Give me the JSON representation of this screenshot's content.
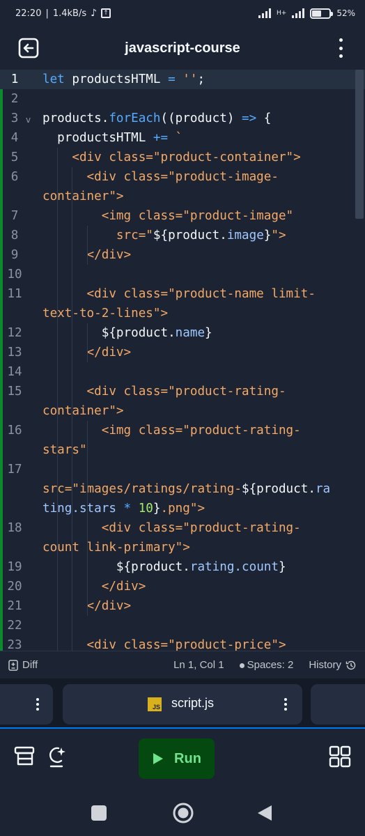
{
  "statusbar": {
    "time": "22:20",
    "network_speed": "1.4kB/s",
    "network_type": "H+",
    "battery_percent": "52",
    "battery_label": "52"
  },
  "header": {
    "title": "javascript-course",
    "back_icon": "exit-icon",
    "menu_icon": "kebab-menu-icon"
  },
  "editor": {
    "active_line": 1,
    "lines": [
      {
        "n": "1",
        "fold": ""
      },
      {
        "n": "2",
        "fold": ""
      },
      {
        "n": "3",
        "fold": "v"
      },
      {
        "n": "4",
        "fold": ""
      },
      {
        "n": "5",
        "fold": ""
      },
      {
        "n": "6",
        "fold": ""
      },
      {
        "n": "",
        "fold": ""
      },
      {
        "n": "7",
        "fold": ""
      },
      {
        "n": "8",
        "fold": ""
      },
      {
        "n": "9",
        "fold": ""
      },
      {
        "n": "10",
        "fold": ""
      },
      {
        "n": "11",
        "fold": ""
      },
      {
        "n": "",
        "fold": ""
      },
      {
        "n": "12",
        "fold": ""
      },
      {
        "n": "13",
        "fold": ""
      },
      {
        "n": "14",
        "fold": ""
      },
      {
        "n": "15",
        "fold": ""
      },
      {
        "n": "",
        "fold": ""
      },
      {
        "n": "16",
        "fold": ""
      },
      {
        "n": "",
        "fold": ""
      },
      {
        "n": "17",
        "fold": ""
      },
      {
        "n": "",
        "fold": ""
      },
      {
        "n": "",
        "fold": ""
      },
      {
        "n": "18",
        "fold": ""
      },
      {
        "n": "",
        "fold": ""
      },
      {
        "n": "19",
        "fold": ""
      },
      {
        "n": "20",
        "fold": ""
      },
      {
        "n": "21",
        "fold": ""
      },
      {
        "n": "22",
        "fold": ""
      },
      {
        "n": "23",
        "fold": ""
      }
    ],
    "code": [
      [
        [
          "k",
          "let "
        ],
        [
          "o",
          "productsHTML "
        ],
        [
          "k",
          "= "
        ],
        [
          "s",
          "''"
        ],
        [
          "o",
          ";"
        ]
      ],
      [],
      [
        [
          "o",
          "products."
        ],
        [
          "f",
          "forEach"
        ],
        [
          "o",
          "((product) "
        ],
        [
          "k",
          "=>"
        ],
        [
          "o",
          " {"
        ]
      ],
      [
        [
          "o",
          "  productsHTML "
        ],
        [
          "k",
          "+="
        ],
        [
          "s",
          " `"
        ]
      ],
      [
        [
          "s",
          "    <div class=\"product-container\">"
        ]
      ],
      [
        [
          "s",
          "      <div class=\"product-image-"
        ]
      ],
      [
        [
          "s",
          "container\">"
        ]
      ],
      [
        [
          "s",
          "        <img class=\"product-image\""
        ]
      ],
      [
        [
          "s",
          "          src=\""
        ],
        [
          "o",
          "${product."
        ],
        [
          "p",
          "image"
        ],
        [
          "o",
          "}"
        ],
        [
          "s",
          "\">"
        ]
      ],
      [
        [
          "s",
          "      </div>"
        ]
      ],
      [],
      [
        [
          "s",
          "      <div class=\"product-name limit-"
        ]
      ],
      [
        [
          "s",
          "text-to-2-lines\">"
        ]
      ],
      [
        [
          "o",
          "        ${product."
        ],
        [
          "p",
          "name"
        ],
        [
          "o",
          "}"
        ]
      ],
      [
        [
          "s",
          "      </div>"
        ]
      ],
      [],
      [
        [
          "s",
          "      <div class=\"product-rating-"
        ]
      ],
      [
        [
          "s",
          "container\">"
        ]
      ],
      [
        [
          "s",
          "        <img class=\"product-rating-"
        ]
      ],
      [
        [
          "s",
          "stars\""
        ]
      ],
      [],
      [
        [
          "s",
          "src=\"images/ratings/rating-"
        ],
        [
          "o",
          "${product."
        ],
        [
          "p",
          "ra"
        ]
      ],
      [
        [
          "p",
          "ting.stars "
        ],
        [
          "k",
          "* "
        ],
        [
          "n",
          "10"
        ],
        [
          "o",
          "}"
        ],
        [
          "s",
          ".png\">"
        ]
      ],
      [
        [
          "s",
          "        <div class=\"product-rating-"
        ]
      ],
      [
        [
          "s",
          "count link-primary\">"
        ]
      ],
      [
        [
          "o",
          "          ${product."
        ],
        [
          "p",
          "rating.count"
        ],
        [
          "o",
          "}"
        ]
      ],
      [
        [
          "s",
          "        </div>"
        ]
      ],
      [
        [
          "s",
          "      </div>"
        ]
      ],
      [],
      [
        [
          "s",
          "      <div class=\"product-price\">"
        ]
      ]
    ]
  },
  "editor_status": {
    "diff_label": "Diff",
    "cursor": "Ln 1, Col 1",
    "spaces": "Spaces: 2",
    "history_label": "History"
  },
  "tabs": {
    "active_file": "script.js",
    "js_badge": "JS"
  },
  "toolbar": {
    "run_label": "Run"
  },
  "colors": {
    "background": "#1c2333",
    "keyword": "#57abff",
    "string": "#f5a966",
    "number": "#a2ea6a",
    "run_button": "#044a10",
    "run_text": "#6fe38d",
    "accent": "#0079f2"
  }
}
